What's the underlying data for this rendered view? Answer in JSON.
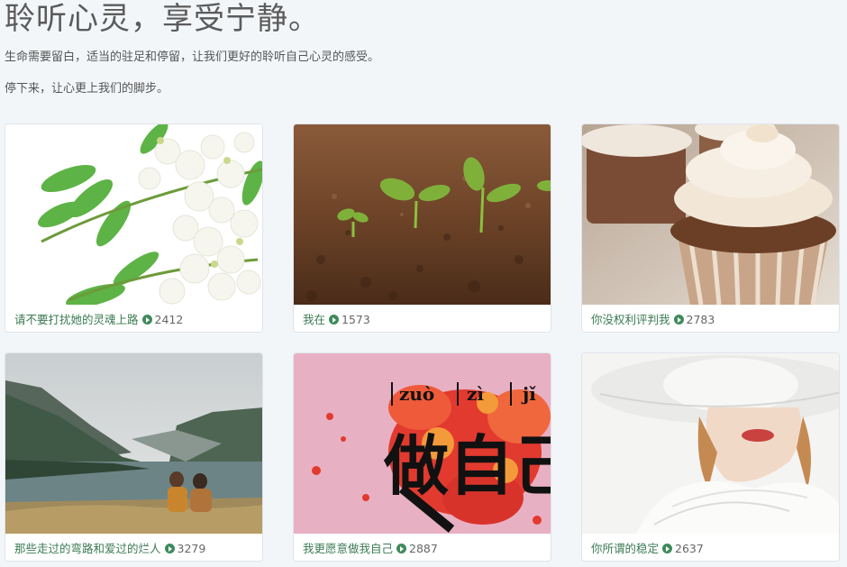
{
  "hero": {
    "title": "聆听心灵，享受宁静。",
    "line1": "生命需要留白，适当的驻足和停留，让我们更好的聆听自己心灵的感受。",
    "line2": "停下来，让心更上我们的脚步。"
  },
  "cards": [
    {
      "title": "请不要打扰她的灵魂上路",
      "plays": "2412",
      "icon": "play-circle-icon"
    },
    {
      "title": "我在",
      "plays": "1573",
      "icon": "play-circle-icon"
    },
    {
      "title": "你没权利评判我",
      "plays": "2783",
      "icon": "play-circle-icon"
    },
    {
      "title": "那些走过的弯路和爱过的烂人",
      "plays": "3279",
      "icon": "play-circle-icon"
    },
    {
      "title": "我更愿意做我自己",
      "plays": "2887",
      "icon": "play-circle-icon"
    },
    {
      "title": "你所谓的稳定",
      "plays": "2637",
      "icon": "play-circle-icon"
    }
  ],
  "poster": {
    "pinyin": [
      "zuò",
      "zì",
      "jǐ"
    ],
    "hanzi": "做自己"
  },
  "colors": {
    "background": "#f3f6f9",
    "accent_text": "#3a7a52",
    "play_icon": "#3f8a5c"
  }
}
